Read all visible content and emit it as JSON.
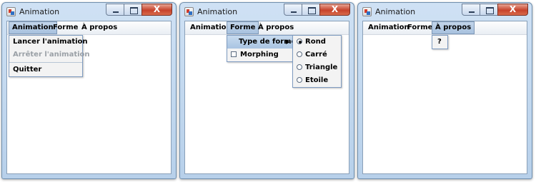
{
  "windows": [
    {
      "title": "Animation",
      "menubar": [
        "Animation",
        "Forme",
        "À propos"
      ],
      "open_menu": {
        "items": [
          {
            "label": "Lancer l'animation",
            "enabled": true
          },
          {
            "label": "Arrêter l'animation",
            "enabled": false
          },
          {
            "label": "Quitter",
            "enabled": true
          }
        ]
      }
    },
    {
      "title": "Animation",
      "menubar": [
        "Animation",
        "Forme",
        "À propos"
      ],
      "open_menu": {
        "items": [
          {
            "label": "Type de forme",
            "submenu_arrow": "▶"
          },
          {
            "label": "Morphing",
            "checked": false
          }
        ]
      },
      "submenu": {
        "items": [
          {
            "label": "Rond",
            "selected": true
          },
          {
            "label": "Carré",
            "selected": false
          },
          {
            "label": "Triangle",
            "selected": false
          },
          {
            "label": "Etoile",
            "selected": false
          }
        ]
      }
    },
    {
      "title": "Animation",
      "menubar": [
        "Animation",
        "Forme",
        "À propos"
      ],
      "open_menu": {
        "items": [
          {
            "label": "?"
          }
        ]
      }
    }
  ],
  "icons": {
    "app": "java-app-icon",
    "minimize": "minimize-icon",
    "maximize": "maximize-icon",
    "close": "close-icon",
    "close_glyph": "X"
  },
  "colors": {
    "menu_highlight": "#a9c4e2",
    "close_button": "#c7432c",
    "disabled_text": "#9aa0a6"
  }
}
